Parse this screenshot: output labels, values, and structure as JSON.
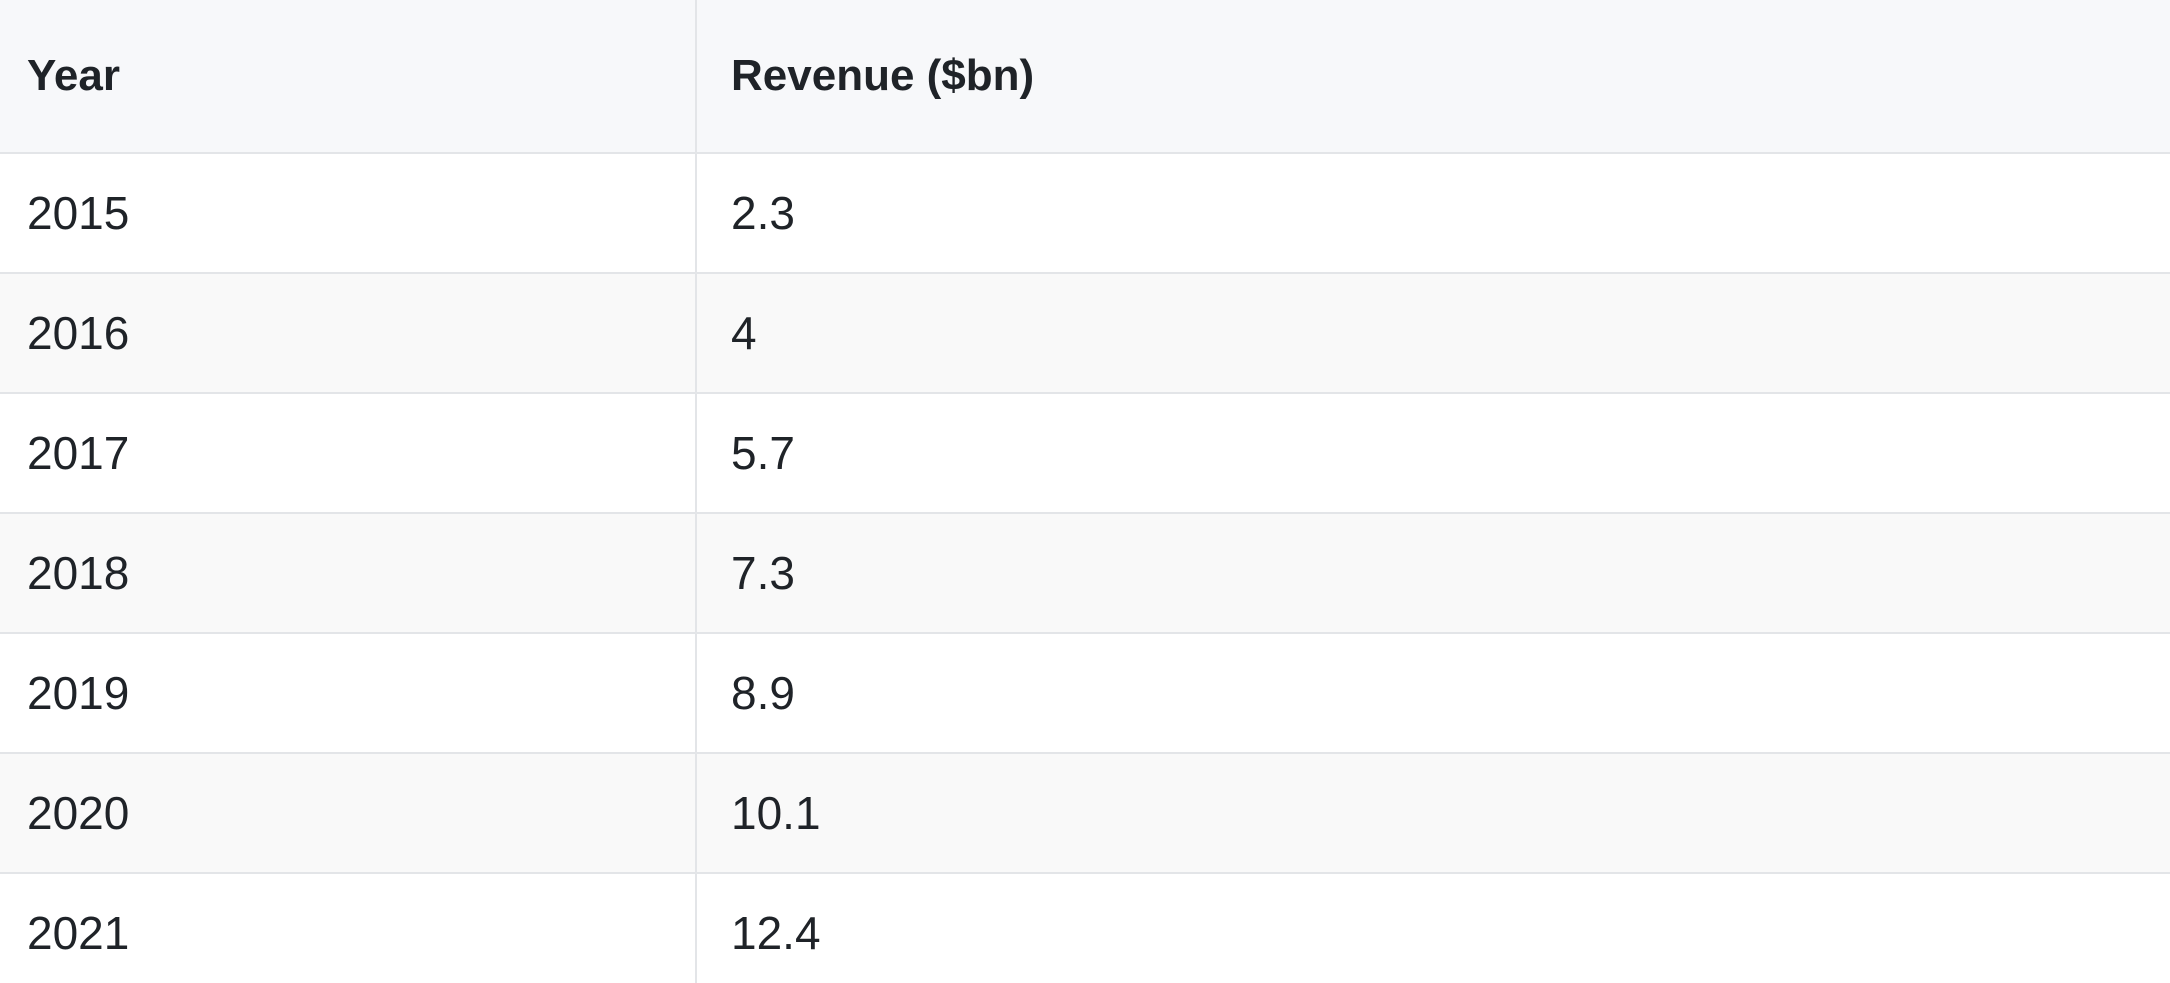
{
  "chart_data": {
    "type": "table",
    "columns": [
      "Year",
      "Revenue ($bn)"
    ],
    "rows": [
      [
        "2015",
        "2.3"
      ],
      [
        "2016",
        "4"
      ],
      [
        "2017",
        "5.7"
      ],
      [
        "2018",
        "7.3"
      ],
      [
        "2019",
        "8.9"
      ],
      [
        "2020",
        "10.1"
      ],
      [
        "2021",
        "12.4"
      ]
    ]
  }
}
